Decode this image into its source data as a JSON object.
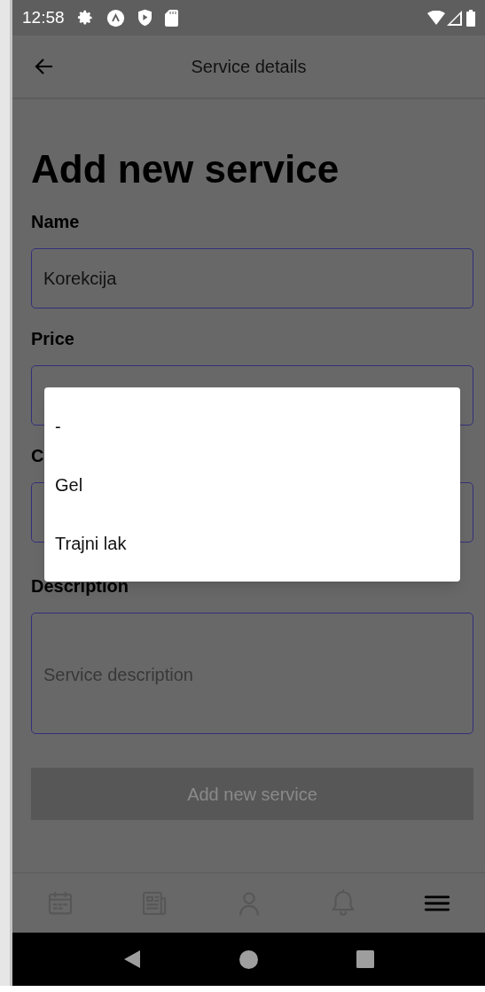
{
  "status_bar": {
    "time": "12:58"
  },
  "header": {
    "title": "Service details"
  },
  "form": {
    "title": "Add new service",
    "fields": [
      {
        "label": "Name",
        "value": "Korekcija",
        "kind": "input"
      },
      {
        "label": "Price",
        "kind": "input"
      },
      {
        "label": "C",
        "kind": "input"
      },
      {
        "label": "Description",
        "placeholder": "Service description",
        "kind": "textarea"
      }
    ],
    "submit": {
      "label": "Add new service",
      "disabled": true
    }
  },
  "dropdown": {
    "options": [
      {
        "label": "-",
        "selected": false
      },
      {
        "label": "Gel",
        "selected": false
      },
      {
        "label": "Trajni lak",
        "selected": false
      }
    ]
  },
  "bottom_nav": [
    {
      "kind": "calendar",
      "selected": false
    },
    {
      "kind": "news",
      "selected": false
    },
    {
      "kind": "profile",
      "selected": false
    },
    {
      "kind": "bell",
      "selected": false
    },
    {
      "kind": "menu",
      "selected": true
    }
  ]
}
